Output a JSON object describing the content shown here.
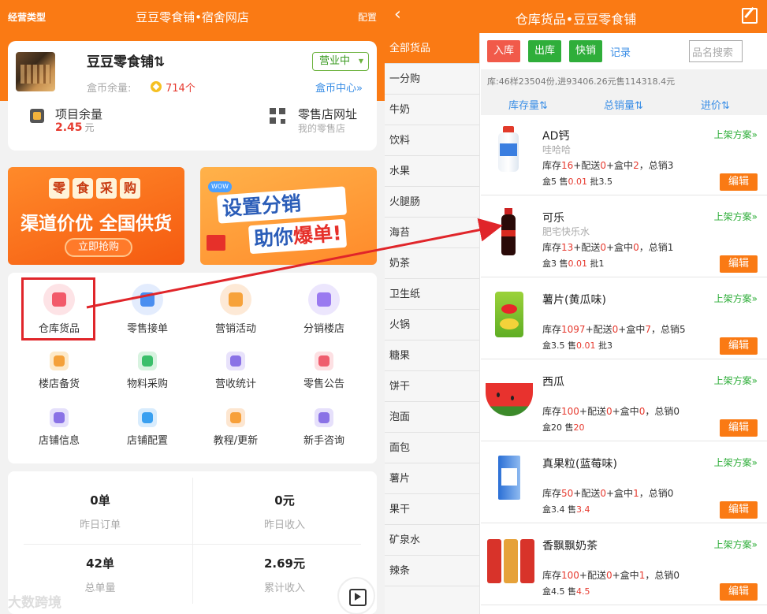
{
  "left": {
    "header": {
      "type_label": "经营类型",
      "title": "豆豆零食铺•宿舍网店",
      "config_label": "配置"
    },
    "shop": {
      "name": "豆豆零食铺⇅",
      "status": "营业中",
      "coin_label": "盒币余量:",
      "coin_value": "714个",
      "coin_center": "盒币中心»",
      "project_label": "项目余量",
      "project_value": "2.45",
      "project_unit": "元",
      "store_label": "零售店网址",
      "store_sub": "我的零售店"
    },
    "banners": {
      "b1_top": [
        "零",
        "食",
        "采",
        "购"
      ],
      "b1_main": "渠道价优 全国供货",
      "b1_button": "立即抢购",
      "b2_line1": "设置分销",
      "b2_line2_a": "助你",
      "b2_line2_b": "爆单!",
      "b2_wow": "WOW"
    },
    "menu": [
      {
        "label": "仓库货品",
        "icon": "warehouse-icon",
        "color": "#fde3e6",
        "accent": "#f25a6a"
      },
      {
        "label": "零售接单",
        "icon": "order-icon",
        "color": "#e3ecfd",
        "accent": "#4a8ef0"
      },
      {
        "label": "营销活动",
        "icon": "marketing-icon",
        "color": "#fde9d6",
        "accent": "#f7a23a"
      },
      {
        "label": "分销楼店",
        "icon": "distribution-icon",
        "color": "#ece6fd",
        "accent": "#9a7af0"
      },
      {
        "label": "楼店备货",
        "icon": "stock-icon",
        "color": "#fde9c8",
        "accent": "#f4a13a"
      },
      {
        "label": "物料采购",
        "icon": "purchase-icon",
        "color": "#d8f3e0",
        "accent": "#3bbf6a"
      },
      {
        "label": "营收统计",
        "icon": "stats-icon",
        "color": "#e8e2fb",
        "accent": "#8a72e6"
      },
      {
        "label": "零售公告",
        "icon": "notice-icon",
        "color": "#fde0e3",
        "accent": "#ef5d6e"
      },
      {
        "label": "店铺信息",
        "icon": "info-icon",
        "color": "#e5e0fb",
        "accent": "#8a72e6"
      },
      {
        "label": "店铺配置",
        "icon": "settings-icon",
        "color": "#d8ecfd",
        "accent": "#3aa0f0"
      },
      {
        "label": "教程/更新",
        "icon": "tutorial-icon",
        "color": "#fde6d0",
        "accent": "#f7a03a"
      },
      {
        "label": "新手咨询",
        "icon": "help-icon",
        "color": "#e6e0fb",
        "accent": "#8a72e6"
      }
    ],
    "stats": [
      {
        "value": "0单",
        "label": "昨日订单"
      },
      {
        "value": "0元",
        "label": "昨日收入"
      },
      {
        "value": "42单",
        "label": "总单量"
      },
      {
        "value": "2.69元",
        "label": "累计收入"
      }
    ],
    "watermark": "大数跨境"
  },
  "right": {
    "header": {
      "back": "‹",
      "title": "仓库货品•豆豆零食铺"
    },
    "categories": [
      "全部货品",
      "一分购",
      "牛奶",
      "饮料",
      "水果",
      "火腿肠",
      "海苔",
      "奶茶",
      "卫生纸",
      "火锅",
      "糖果",
      "饼干",
      "泡面",
      "面包",
      "薯片",
      "果干",
      "矿泉水",
      "辣条"
    ],
    "toolbar": {
      "in": "入库",
      "out": "出库",
      "quick": "快销",
      "record": "记录",
      "search_placeholder": "品名搜索"
    },
    "summary": "库:46样23504份,进93406.26元售114318.4元",
    "sorts": [
      "库存量⇅",
      "总销量⇅",
      "进价⇅"
    ],
    "labels": {
      "stock": "库存",
      "dist": "+配送",
      "box": "+盒中",
      "sold": "，总销",
      "box_p": "盒",
      "sell_p": "售",
      "batch": "批",
      "plan": "上架方案»",
      "edit": "编辑"
    },
    "products": [
      {
        "name": "AD钙",
        "sub": "哇哈哈",
        "stock": "16",
        "dist": "0",
        "box": "2",
        "sold": "3",
        "box_price": "5",
        "sell_price": "0.01",
        "batch": "3.5",
        "img": "bottle-white"
      },
      {
        "name": "可乐",
        "sub": "肥宅快乐水",
        "stock": "13",
        "dist": "0",
        "box": "0",
        "sold": "1",
        "box_price": "3",
        "sell_price": "0.01",
        "batch": "1",
        "img": "cola"
      },
      {
        "name": "薯片(黄瓜味)",
        "sub": "",
        "stock": "1097",
        "dist": "0",
        "box": "7",
        "sold": "5",
        "box_price": "3.5",
        "sell_price": "0.01",
        "batch": "3",
        "img": "chips"
      },
      {
        "name": "西瓜",
        "sub": "",
        "stock": "100",
        "dist": "0",
        "box": "0",
        "sold": "0",
        "box_price": "20",
        "sell_price": "20",
        "batch": "",
        "img": "watermelon"
      },
      {
        "name": "真果粒(蓝莓味)",
        "sub": "",
        "stock": "50",
        "dist": "0",
        "box": "1",
        "sold": "0",
        "box_price": "3.4",
        "sell_price": "3.4",
        "batch": "",
        "img": "milk-box"
      },
      {
        "name": "香飘飘奶茶",
        "sub": "",
        "stock": "100",
        "dist": "0",
        "box": "1",
        "sold": "0",
        "box_price": "4.5",
        "sell_price": "4.5",
        "batch": "",
        "img": "tea-cups"
      }
    ]
  }
}
